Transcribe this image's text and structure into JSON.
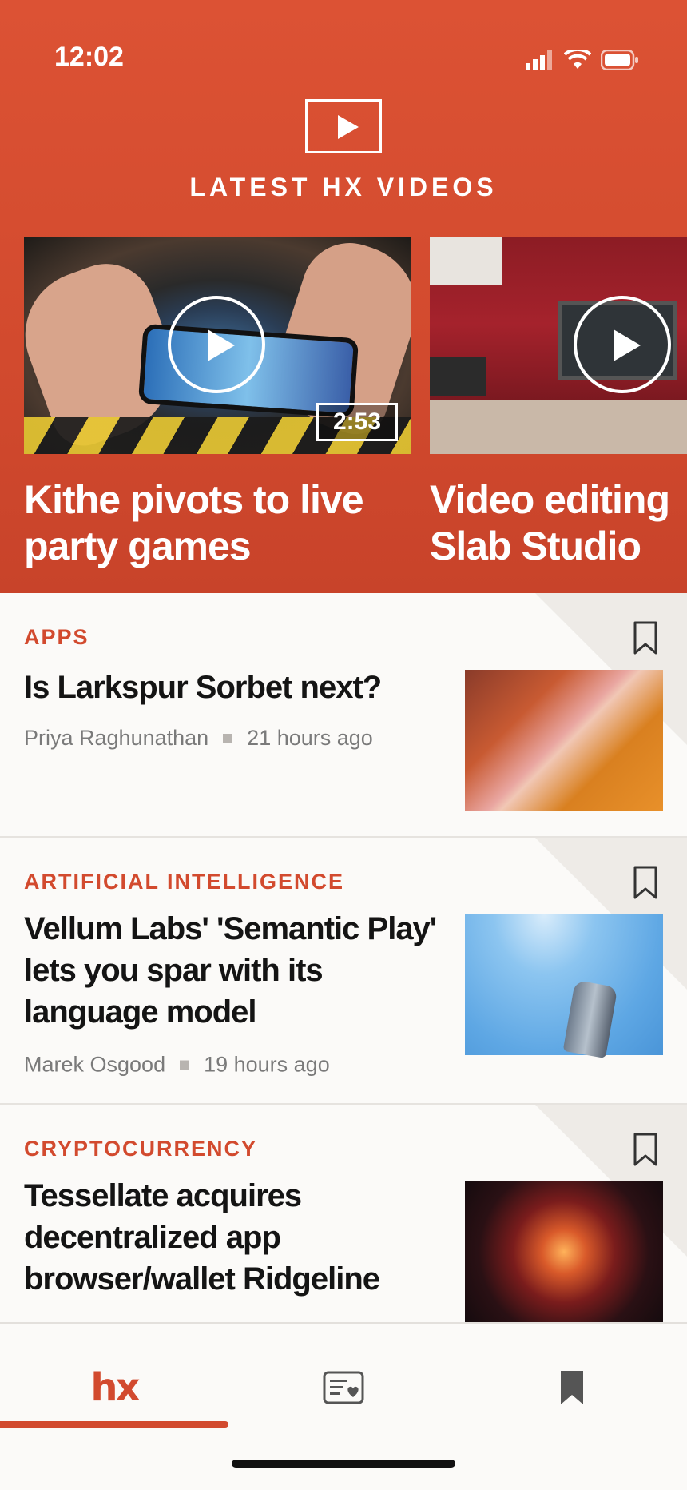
{
  "status_bar": {
    "time": "12:02"
  },
  "hero": {
    "section_title": "LATEST HX VIDEOS",
    "videos": [
      {
        "title_line1": "Kithe pivots to live",
        "title_line2": "party games",
        "duration": "2:53"
      },
      {
        "title_line1": "Video editing",
        "title_line2": "Slab Studio"
      }
    ]
  },
  "articles": [
    {
      "category": "APPS",
      "headline": "Is Larkspur Sorbet next?",
      "author": "Priya Raghunathan",
      "time": "21 hours ago"
    },
    {
      "category": "ARTIFICIAL INTELLIGENCE",
      "headline": "Vellum Labs' 'Semantic Play' lets you spar with its language model",
      "author": "Marek Osgood",
      "time": "19 hours ago"
    },
    {
      "category": "CRYPTOCURRENCY",
      "headline": "Tessellate acquires decentralized app browser/wallet Ridgeline"
    }
  ],
  "tabbar": {
    "home_label": "hx",
    "icons": [
      "hx-logo-icon",
      "newsletter-icon",
      "bookmark-icon"
    ]
  },
  "colors": {
    "accent": "#d24a2e",
    "background": "#fbfaf8"
  }
}
